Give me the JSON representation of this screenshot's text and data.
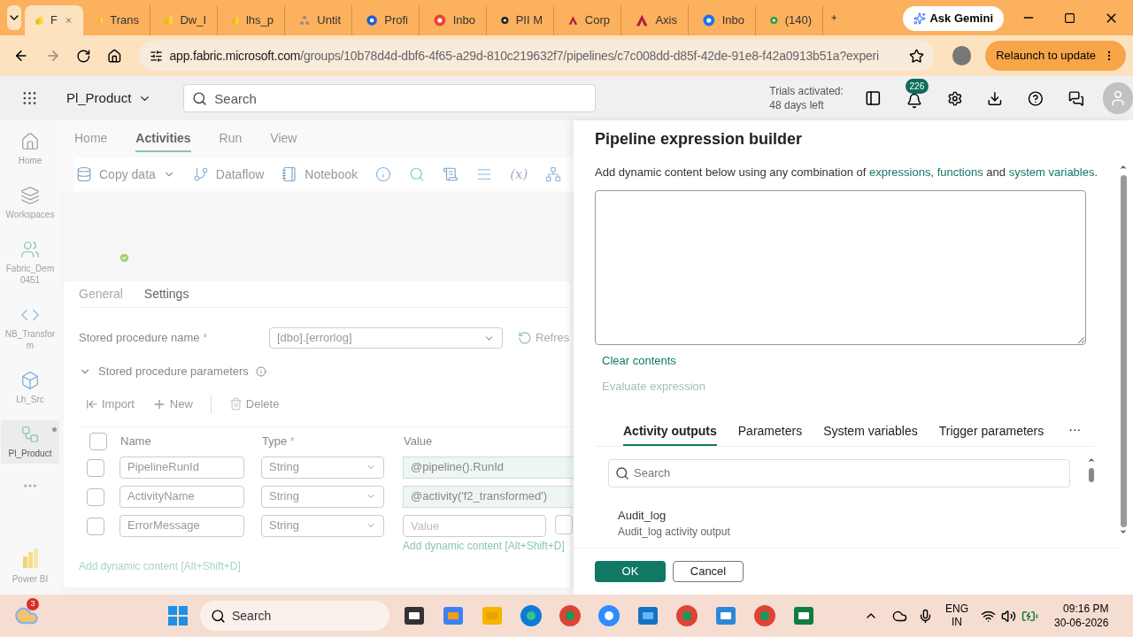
{
  "browser": {
    "tabs": [
      {
        "label": "F",
        "kind": "powerbi",
        "selected": true
      },
      {
        "label": "Trans",
        "kind": "powerbi",
        "selected": false
      },
      {
        "label": "Dw_I",
        "kind": "powerbi",
        "selected": false
      },
      {
        "label": "lhs_p",
        "kind": "powerbi",
        "selected": false
      },
      {
        "label": "Untit",
        "kind": "fabric",
        "selected": false
      },
      {
        "label": "Profi",
        "kind": "profile",
        "selected": false
      },
      {
        "label": "Inbo",
        "kind": "gmail",
        "selected": false
      },
      {
        "label": "PII M",
        "kind": "chat",
        "selected": false
      },
      {
        "label": "Corp",
        "kind": "axis",
        "selected": false
      },
      {
        "label": "Axis",
        "kind": "axis",
        "selected": false
      },
      {
        "label": "Inbo",
        "kind": "outlook",
        "selected": false
      },
      {
        "label": "(140)",
        "kind": "whatsapp",
        "selected": false
      }
    ],
    "gemini": "Ask Gemini",
    "url_host": "app.fabric.microsoft.com",
    "url_path": "/groups/10b78d4d-dbf6-4f65-a29d-810c219632f7/pipelines/c7c008dd-d85f-42de-91e8-f42a0913b51a?experi",
    "relaunch": "Relaunch to update"
  },
  "header": {
    "workspace": "Pl_Product",
    "search_placeholder": "Search",
    "trial": [
      "Trials activated:",
      "48 days left"
    ],
    "notifications": "226"
  },
  "rail": [
    {
      "label": "Home",
      "kind": "home",
      "selected": false
    },
    {
      "label": "Workspaces",
      "kind": "workspaces",
      "selected": false
    },
    {
      "label": "Fabric_Dem 0451",
      "kind": "people",
      "selected": false
    },
    {
      "label": "NB_Transform",
      "kind": "notebook",
      "selected": false
    },
    {
      "label": "Lh_Src",
      "kind": "lakehouse",
      "selected": false
    },
    {
      "label": "Pl_Product",
      "kind": "pipeline",
      "selected": true
    }
  ],
  "rail_bottom": "Power BI",
  "ribbon": {
    "tabs": [
      {
        "label": "Home",
        "selected": false
      },
      {
        "label": "Activities",
        "selected": true
      },
      {
        "label": "Run",
        "selected": false
      },
      {
        "label": "View",
        "selected": false
      }
    ],
    "tools": [
      {
        "label": "Copy data",
        "kind": "copy"
      },
      {
        "label": "Dataflow",
        "kind": "dataflow"
      },
      {
        "label": "Notebook",
        "kind": "notebook"
      }
    ],
    "icon_tools": [
      {
        "kind": "info"
      },
      {
        "kind": "search"
      },
      {
        "kind": "script"
      },
      {
        "kind": "lines"
      },
      {
        "kind": "variable",
        "label": "(x)"
      },
      {
        "kind": "flow"
      }
    ]
  },
  "settings": {
    "tabs": [
      {
        "label": "General",
        "selected": false
      },
      {
        "label": "Settings",
        "selected": true
      }
    ],
    "sp_label": "Stored procedure name",
    "required_mark": "*",
    "sp_value": "[dbo].[errorlog]",
    "refresh": "Refres",
    "params": {
      "title": "Stored procedure parameters",
      "expanded": true,
      "select_all_checked": false,
      "actions": [
        "Import",
        "New",
        "Delete"
      ],
      "columns": [
        {
          "label": "Name"
        },
        {
          "label": "Type",
          "mark": "*"
        },
        {
          "label": "Value"
        }
      ],
      "rows": [
        {
          "checked": false,
          "name": "PipelineRunId",
          "type": "String",
          "value": "@pipeline().RunId"
        },
        {
          "checked": false,
          "name": "ActivityName",
          "type": "String",
          "value": "@activity('f2_transformed')"
        },
        {
          "checked": false,
          "name": "ErrorMessage",
          "type": "String",
          "value_placeholder": "Value",
          "hint": "Add dynamic content [Alt+Shift+D]"
        }
      ]
    },
    "footer_hint": "Add dynamic content [Alt+Shift+D]"
  },
  "panel": {
    "title": "Pipeline expression builder",
    "intro": [
      {
        "text": "Add dynamic content below using any combination of",
        "kind": "text"
      },
      {
        "text": "expressions,",
        "kind": "link"
      },
      {
        "text": "functions",
        "kind": "link"
      },
      {
        "text": "and",
        "kind": "text"
      },
      {
        "text": "system variables.",
        "kind": "link"
      }
    ],
    "clear": "Clear contents",
    "evaluate": {
      "label": "Evaluate expression",
      "disabled": true
    },
    "tabs": [
      {
        "label": "Activity outputs",
        "selected": true
      },
      {
        "label": "Parameters",
        "selected": false
      },
      {
        "label": "System variables",
        "selected": false
      },
      {
        "label": "Trigger parameters",
        "selected": false
      }
    ],
    "more": "···",
    "search_placeholder": "Search",
    "items": [
      {
        "name": "Audit_log",
        "description": "Audit_log activity output"
      }
    ],
    "ok": "OK",
    "cancel": "Cancel"
  },
  "taskbar": {
    "weather_badge": "3",
    "search_placeholder": "Search",
    "apps": [
      {
        "kind": "taskview"
      },
      {
        "kind": "copilot"
      },
      {
        "kind": "files"
      },
      {
        "kind": "edge"
      },
      {
        "kind": "chrome"
      },
      {
        "kind": "zoom"
      },
      {
        "kind": "stack"
      },
      {
        "kind": "chrome"
      },
      {
        "kind": "notepad"
      },
      {
        "kind": "chrome"
      },
      {
        "kind": "excel"
      }
    ],
    "lang": [
      "ENG",
      "IN"
    ],
    "time": "09:16 PM",
    "date": "30-06-2026"
  }
}
